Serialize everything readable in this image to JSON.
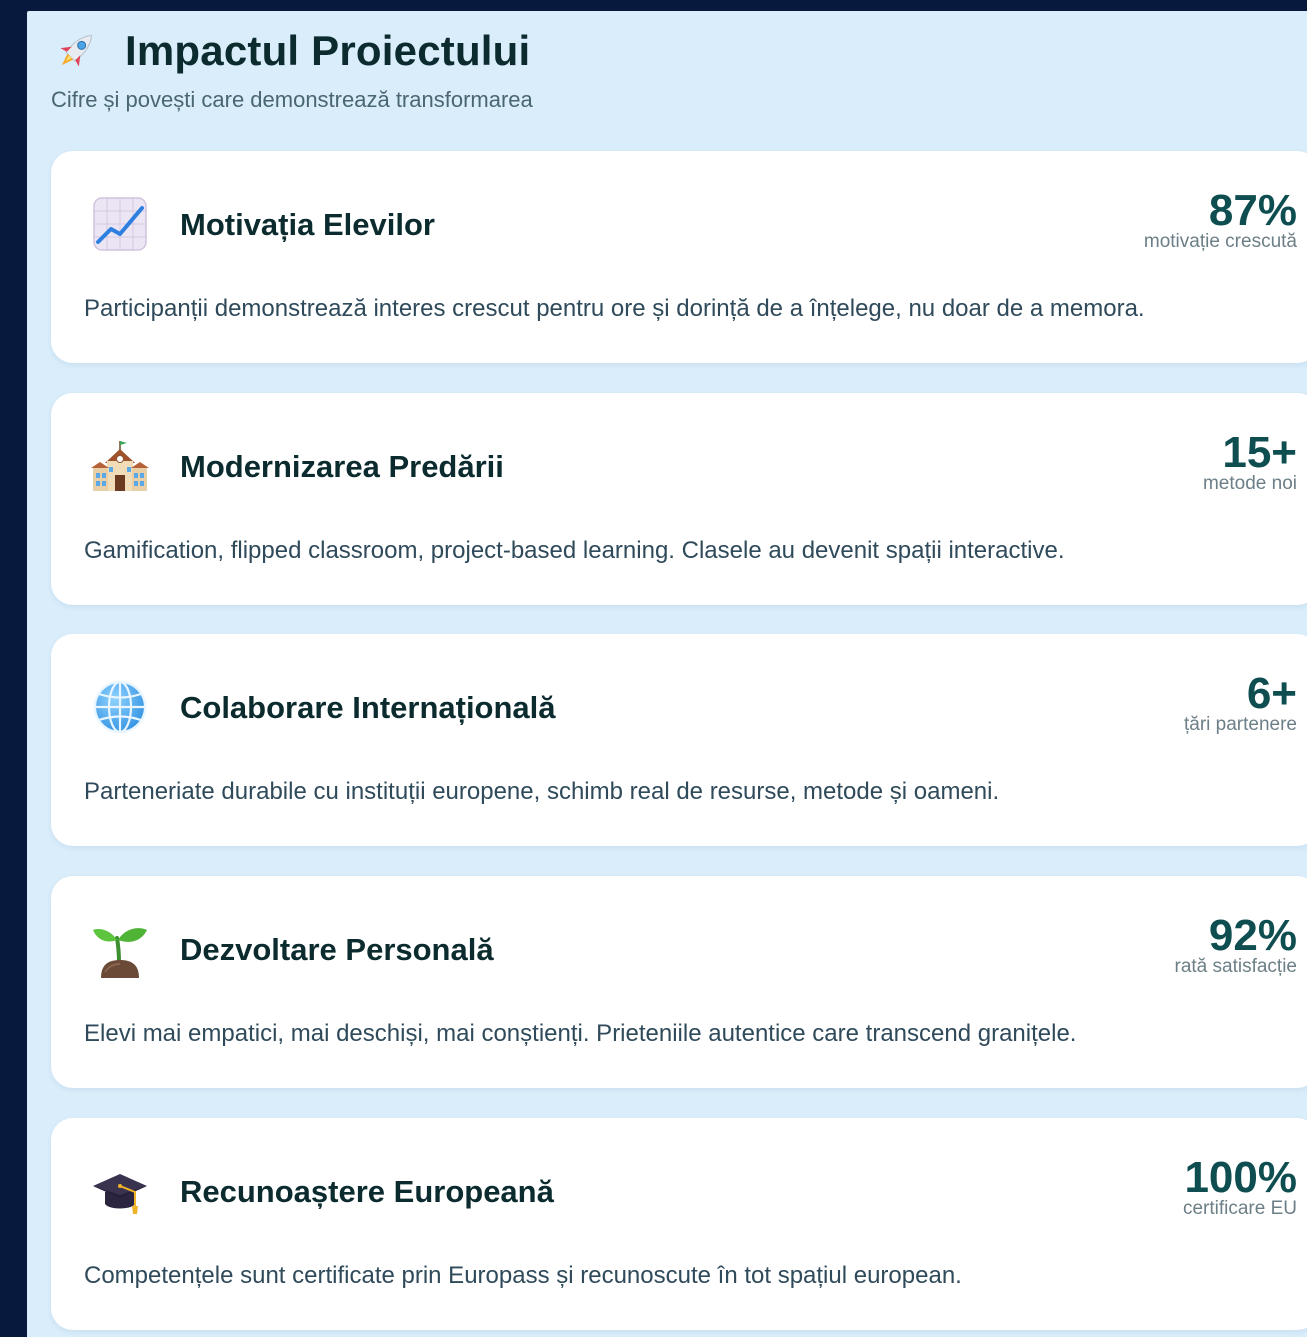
{
  "header": {
    "title": "Impactul Proiectului",
    "subtitle": "Cifre și povești care demonstrează transformarea",
    "icon": "rocket-icon"
  },
  "cards": [
    {
      "icon": "chart-increasing-icon",
      "title": "Motivația Elevilor",
      "stat_value": "87%",
      "stat_label": "motivație crescută",
      "description": "Participanții demonstrează interes crescut pentru ore și dorință de a înțelege, nu doar de a memora."
    },
    {
      "icon": "school-icon",
      "title": "Modernizarea Predării",
      "stat_value": "15+",
      "stat_label": "metode noi",
      "description": "Gamification, flipped classroom, project-based learning. Clasele au devenit spații interactive."
    },
    {
      "icon": "globe-icon",
      "title": "Colaborare Internațională",
      "stat_value": "6+",
      "stat_label": "țări partenere",
      "description": "Parteneriate durabile cu instituții europene, schimb real de resurse, metode și oameni."
    },
    {
      "icon": "seedling-icon",
      "title": "Dezvoltare Personală",
      "stat_value": "92%",
      "stat_label": "rată satisfacție",
      "description": "Elevi mai empatici, mai deschiși, mai conștienți. Prieteniile autentice care transcend granițele."
    },
    {
      "icon": "graduation-cap-icon",
      "title": "Recunoaștere Europeană",
      "stat_value": "100%",
      "stat_label": "certificare EU",
      "description": "Competențele sunt certificate prin Europass și recunoscute în tot spațiul european."
    }
  ],
  "colors": {
    "background": "#071a3d",
    "panel": "#d9edfb",
    "card": "#ffffff",
    "title": "#0b2b2e",
    "stat": "#0e4d50"
  }
}
